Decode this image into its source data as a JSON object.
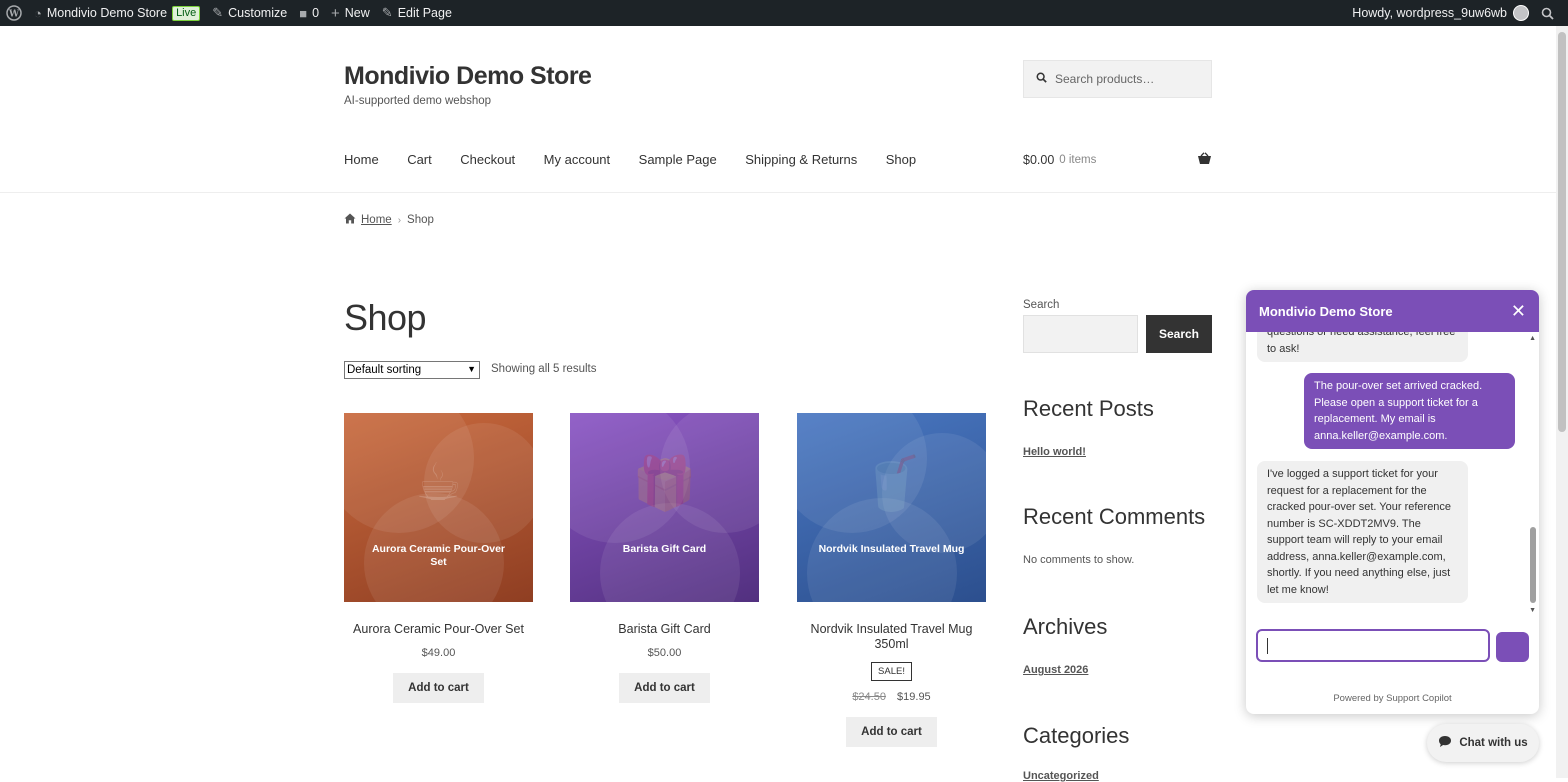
{
  "admin_bar": {
    "site_name": "Mondivio Demo Store",
    "live_badge": "Live",
    "customize": "Customize",
    "comments_count": "0",
    "new": "New",
    "edit_page": "Edit Page",
    "howdy": "Howdy, wordpress_9uw6wb",
    "icons": [
      "wordpress-logo-icon",
      "dashboard-icon",
      "brush-icon",
      "comment-icon",
      "plus-icon",
      "pencil-icon",
      "avatar",
      "search-icon"
    ]
  },
  "header": {
    "title": "Mondivio Demo Store",
    "description": "AI-supported demo webshop",
    "search_placeholder": "Search products…",
    "nav": [
      "Home",
      "Cart",
      "Checkout",
      "My account",
      "Sample Page",
      "Shipping & Returns",
      "Shop"
    ],
    "cart_total": "$0.00",
    "cart_items": "0 items"
  },
  "breadcrumb": {
    "home": "Home",
    "current": "Shop"
  },
  "shop": {
    "title": "Shop",
    "sorting": "Default sorting",
    "result_count": "Showing all 5 results",
    "add_to_cart": "Add to cart",
    "sale_badge": "SALE!",
    "products": [
      {
        "thumb_label": "Aurora Ceramic Pour-Over Set",
        "name": "Aurora Ceramic Pour-Over Set",
        "price": "$49.00",
        "color": "#b85a34",
        "icon": "coffee-cup-icon"
      },
      {
        "thumb_label": "Barista Gift Card",
        "name": "Barista Gift Card",
        "price": "$50.00",
        "color": "#6a3fa0",
        "icon": "gift-icon"
      },
      {
        "thumb_label": "Nordvik Insulated Travel Mug",
        "name": "Nordvik Insulated Travel Mug 350ml",
        "old_price": "$24.50",
        "price": "$19.95",
        "color": "#3d62a8",
        "icon": "travel-mug-icon"
      }
    ]
  },
  "sidebar": {
    "search_label": "Search",
    "search_button": "Search",
    "recent_posts_title": "Recent Posts",
    "recent_post": "Hello world!",
    "recent_comments_title": "Recent Comments",
    "no_comments": "No comments to show.",
    "archives_title": "Archives",
    "archive_item": "August 2026",
    "categories_title": "Categories",
    "category_item": "Uncategorized"
  },
  "chat": {
    "title": "Mondivio Demo Store",
    "messages": [
      {
        "role": "bot",
        "text": "questions or need assistance, feel free to ask!"
      },
      {
        "role": "user",
        "text": "The pour-over set arrived cracked. Please open a support ticket for a replacement. My email is anna.keller@example.com."
      },
      {
        "role": "bot",
        "text": "I've logged a support ticket for your request for a replacement for the cracked pour-over set. Your reference number is SC-XDDT2MV9. The support team will reply to your email address, anna.keller@example.com, shortly. If you need anything else, just let me know!"
      }
    ],
    "powered_by": "Powered by Support Copilot",
    "launcher": "Chat with us"
  },
  "colors": {
    "accent": "#7b4fb7",
    "admin_bar": "#1d2327",
    "dark_button": "#333333"
  }
}
